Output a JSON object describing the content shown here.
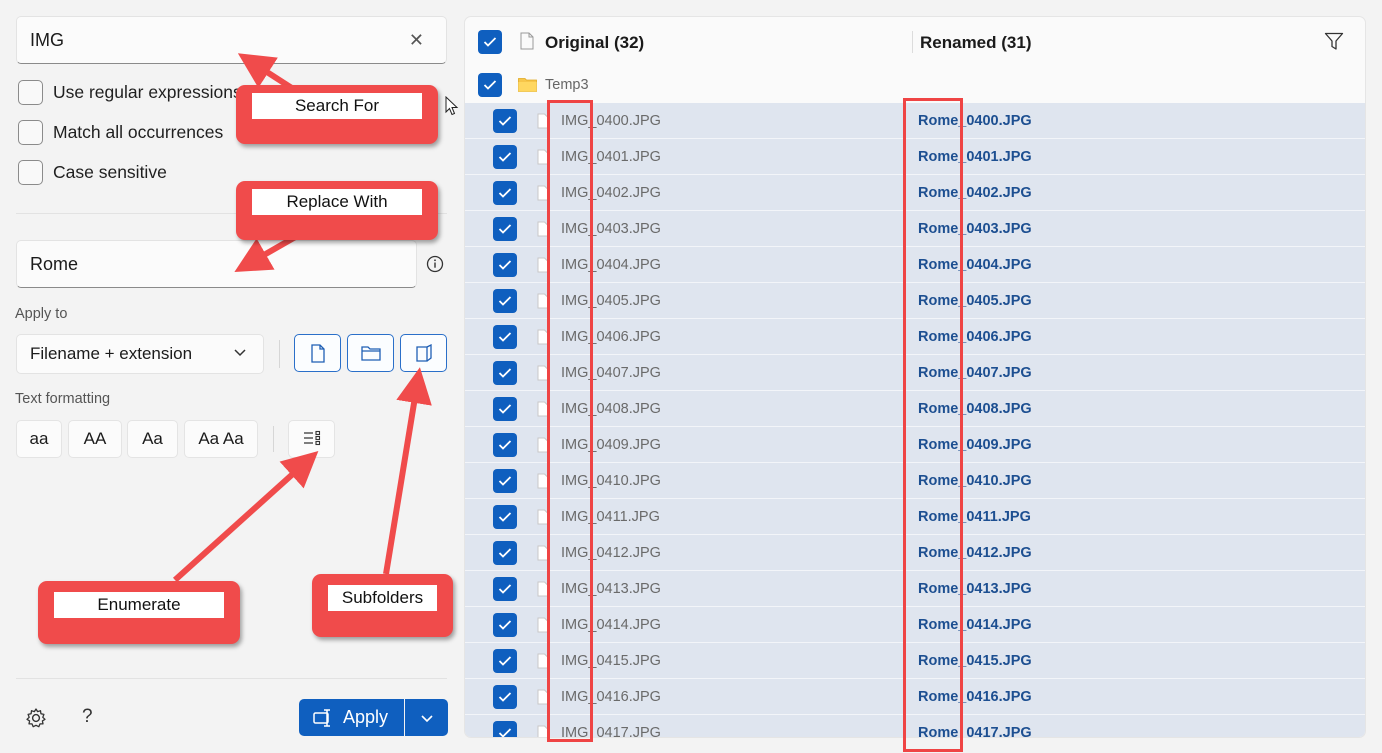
{
  "search": {
    "value": "IMG",
    "clear_icon": "close-icon"
  },
  "options": [
    {
      "label": "Use regular expressions",
      "checked": false
    },
    {
      "label": "Match all occurrences",
      "checked": false
    },
    {
      "label": "Case sensitive",
      "checked": false
    }
  ],
  "replace": {
    "value": "Rome",
    "info_icon": "info-icon"
  },
  "apply_to": {
    "label": "Apply to",
    "selected": "Filename + extension",
    "buttons": [
      "file-icon",
      "folder-icon",
      "subfolder-icon"
    ]
  },
  "text_formatting": {
    "label": "Text formatting",
    "buttons": [
      "aa",
      "AA",
      "Aa",
      "Aa Aa"
    ],
    "enumerate_icon": "enumerate-icon"
  },
  "footer": {
    "settings_icon": "gear-icon",
    "help": "?",
    "apply_label": "Apply"
  },
  "list": {
    "original_header": "Original (32)",
    "renamed_header": "Renamed (31)",
    "folder": "Temp3",
    "rows": [
      {
        "original": "IMG_0400.JPG",
        "renamed": "Rome_0400.JPG"
      },
      {
        "original": "IMG_0401.JPG",
        "renamed": "Rome_0401.JPG"
      },
      {
        "original": "IMG_0402.JPG",
        "renamed": "Rome_0402.JPG"
      },
      {
        "original": "IMG_0403.JPG",
        "renamed": "Rome_0403.JPG"
      },
      {
        "original": "IMG_0404.JPG",
        "renamed": "Rome_0404.JPG"
      },
      {
        "original": "IMG_0405.JPG",
        "renamed": "Rome_0405.JPG"
      },
      {
        "original": "IMG_0406.JPG",
        "renamed": "Rome_0406.JPG"
      },
      {
        "original": "IMG_0407.JPG",
        "renamed": "Rome_0407.JPG"
      },
      {
        "original": "IMG_0408.JPG",
        "renamed": "Rome_0408.JPG"
      },
      {
        "original": "IMG_0409.JPG",
        "renamed": "Rome_0409.JPG"
      },
      {
        "original": "IMG_0410.JPG",
        "renamed": "Rome_0410.JPG"
      },
      {
        "original": "IMG_0411.JPG",
        "renamed": "Rome_0411.JPG"
      },
      {
        "original": "IMG_0412.JPG",
        "renamed": "Rome_0412.JPG"
      },
      {
        "original": "IMG_0413.JPG",
        "renamed": "Rome_0413.JPG"
      },
      {
        "original": "IMG_0414.JPG",
        "renamed": "Rome_0414.JPG"
      },
      {
        "original": "IMG_0415.JPG",
        "renamed": "Rome_0415.JPG"
      },
      {
        "original": "IMG_0416.JPG",
        "renamed": "Rome_0416.JPG"
      },
      {
        "original": "IMG_0417.JPG",
        "renamed": "Rome_0417.JPG"
      }
    ]
  },
  "annotations": {
    "search_for": "Search For",
    "replace_with": "Replace With",
    "enumerate": "Enumerate",
    "subfolders": "Subfolders",
    "color": "#f04b4b"
  },
  "colors": {
    "accent": "#0f5fbf",
    "row_highlight": "#dfe5ef",
    "renamed_text": "#1d4f91"
  }
}
